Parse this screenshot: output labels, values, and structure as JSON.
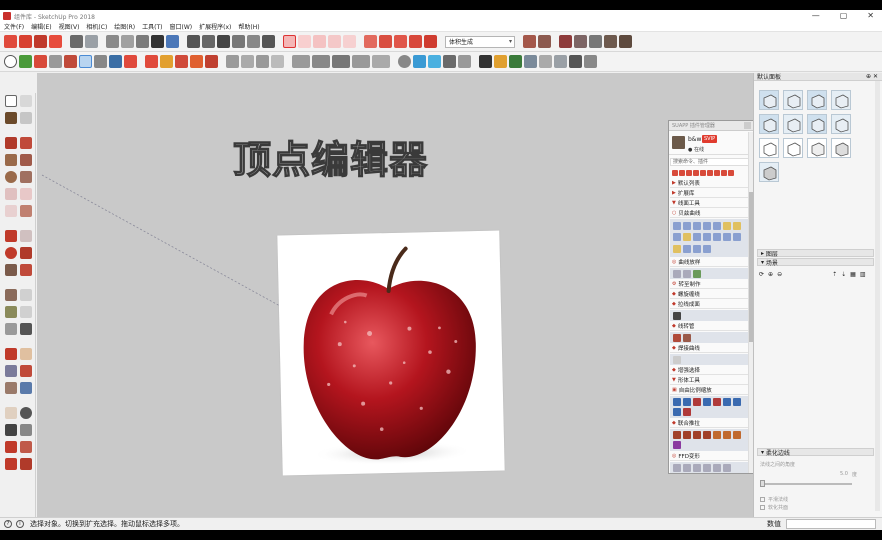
{
  "window": {
    "title": "组件库 - SketchUp Pro 2018",
    "controls": [
      "—",
      "▢",
      "✕"
    ]
  },
  "menu": [
    "文件(F)",
    "编辑(E)",
    "视图(V)",
    "相机(C)",
    "绘图(R)",
    "工具(T)",
    "窗口(W)",
    "扩展程序(x)",
    "帮助(H)"
  ],
  "toolbar": {
    "combo_value": "体积生成"
  },
  "viewport": {
    "title_text": "顶点编辑器"
  },
  "default_tray": {
    "title": "默认面板",
    "sections": [
      "图层",
      "场景",
      "柔化边线"
    ],
    "softedge": {
      "normals_label": "法线之间的角度",
      "angle_value": "5.0",
      "angle_unit": "度",
      "smooth_normals": "平滑法线",
      "soften_coplanar": "软化共面"
    }
  },
  "plugin": {
    "title": "SUAPP 插件管理器",
    "username": "b&w",
    "vip": "SVIP",
    "status": "● 在线",
    "search_placeholder": "搜索命令、插件",
    "categories": [
      {
        "label": "默认列表",
        "open": false
      },
      {
        "label": "扩展库",
        "open": false
      },
      {
        "label": "线面工具",
        "open": true
      },
      {
        "label": "贝兹曲线",
        "open": false
      },
      {
        "label": "曲线放样",
        "open": false
      },
      {
        "label": "转至制作",
        "open": false
      },
      {
        "label": "螺旋缠绕",
        "open": false
      },
      {
        "label": "拉线成面",
        "open": false
      },
      {
        "label": "线转管",
        "open": false
      },
      {
        "label": "焊接曲线",
        "open": false
      },
      {
        "label": "增强选择",
        "open": false
      },
      {
        "label": "形体工具",
        "open": true
      },
      {
        "label": "自由比例缩放",
        "open": false
      },
      {
        "label": "联合推拉",
        "open": false
      },
      {
        "label": "FFD变形",
        "open": false
      }
    ]
  },
  "statusbar": {
    "hint": "选择对象。切换到扩充选择。拖动鼠标选择多项。",
    "measure_label": "数值",
    "measure_value": ""
  },
  "colors": {
    "accent_red": "#d03a2c",
    "viewport_bg": "#c9c9c9",
    "panel_bg": "#f5f5f5"
  }
}
